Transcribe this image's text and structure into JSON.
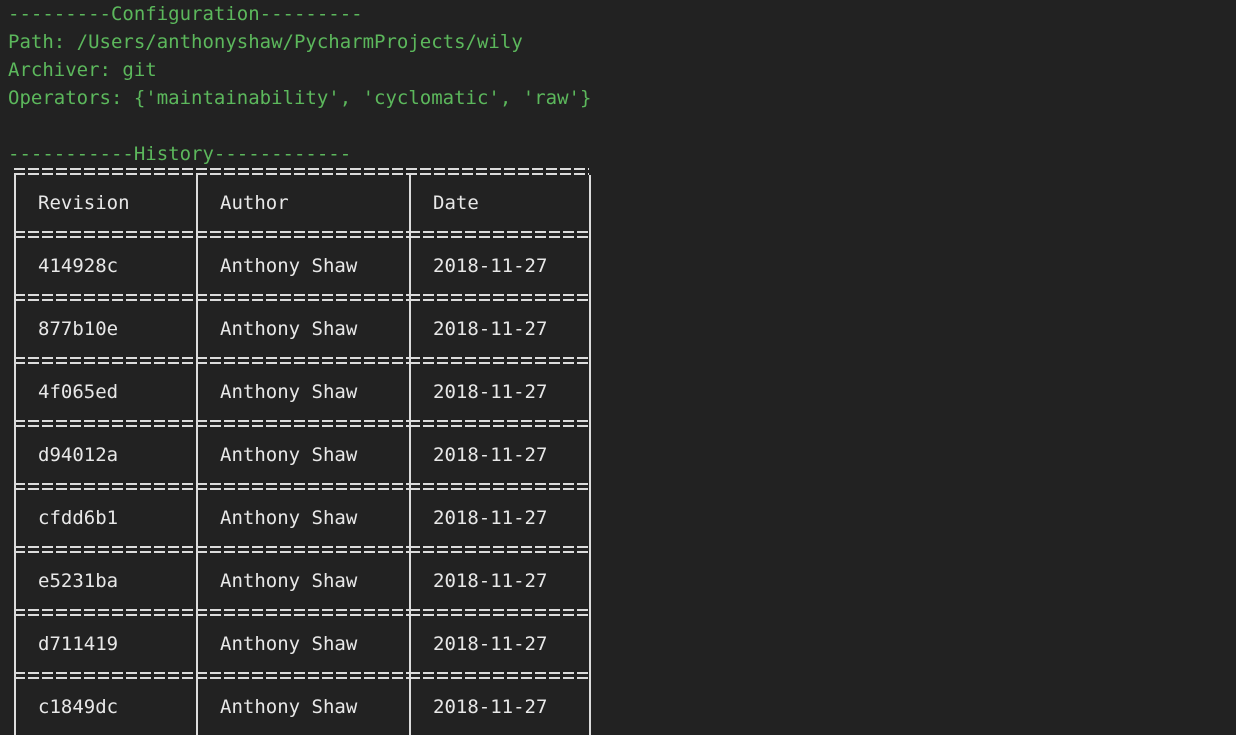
{
  "terminal": {
    "background_color": "#222222",
    "text_color": "#e8e8e8",
    "accent_color": "#5cb85c"
  },
  "configuration": {
    "heading": "---------Configuration---------",
    "path_line": "Path: /Users/anthonyshaw/PycharmProjects/wily",
    "archiver_line": "Archiver: git",
    "operators_line": "Operators: {'maintainability', 'cyclomatic', 'raw'}",
    "blank_line": " "
  },
  "history": {
    "heading": "-----------History------------",
    "columns": [
      "Revision",
      "Author",
      "Date"
    ],
    "rows": [
      {
        "revision": "414928c",
        "author": "Anthony Shaw",
        "date": "2018-11-27"
      },
      {
        "revision": "877b10e",
        "author": "Anthony Shaw",
        "date": "2018-11-27"
      },
      {
        "revision": "4f065ed",
        "author": "Anthony Shaw",
        "date": "2018-11-27"
      },
      {
        "revision": "d94012a",
        "author": "Anthony Shaw",
        "date": "2018-11-27"
      },
      {
        "revision": "cfdd6b1",
        "author": "Anthony Shaw",
        "date": "2018-11-27"
      },
      {
        "revision": "e5231ba",
        "author": "Anthony Shaw",
        "date": "2018-11-27"
      },
      {
        "revision": "d711419",
        "author": "Anthony Shaw",
        "date": "2018-11-27"
      },
      {
        "revision": "c1849dc",
        "author": "Anthony Shaw",
        "date": "2018-11-27"
      }
    ]
  }
}
